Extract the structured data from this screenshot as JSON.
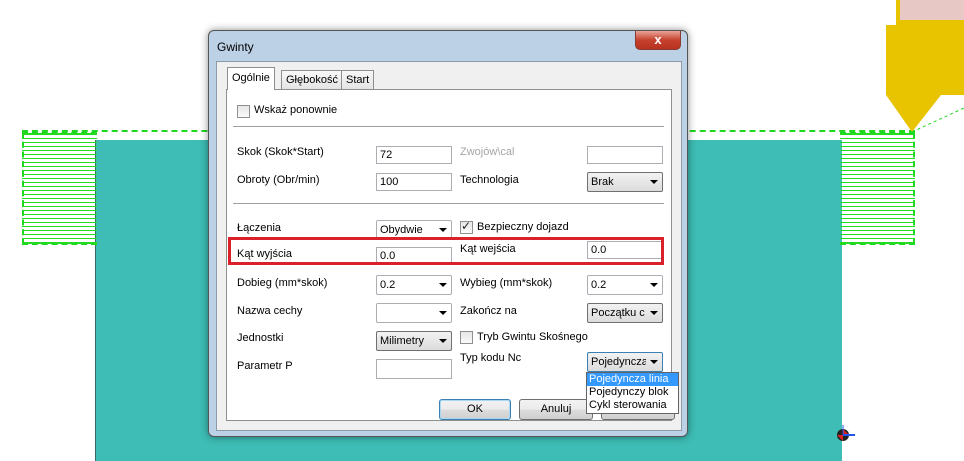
{
  "dialog": {
    "title": "Gwinty",
    "close_glyph": "x",
    "tabs": [
      {
        "label": "Ogólnie",
        "active": true
      },
      {
        "label": "Głębokość",
        "active": false
      },
      {
        "label": "Start",
        "active": false
      }
    ],
    "fields": {
      "show_again": {
        "label": "Wskaż ponownie",
        "checked": false
      },
      "pitch": {
        "label": "Skok (Skok*Start)",
        "value": "72"
      },
      "threads_per_inch": {
        "label": "Zwojów\\cal",
        "value": "",
        "disabled": true
      },
      "rpm": {
        "label": "Obroty (Obr/min)",
        "value": "100"
      },
      "technology": {
        "label": "Technologia",
        "value": "Brak"
      },
      "connections": {
        "label": "Łączenia",
        "value": "Obydwie"
      },
      "safe_approach": {
        "label": "Bezpieczny dojazd",
        "checked": true
      },
      "exit_angle": {
        "label": "Kąt wyjścia",
        "value": "0.0"
      },
      "entry_angle": {
        "label": "Kąt wejścia",
        "value": "0.0"
      },
      "approach": {
        "label": "Dobieg  (mm*skok)",
        "value": "0.2"
      },
      "overrun": {
        "label": "Wybieg (mm*skok)",
        "value": "0.2"
      },
      "feature_name": {
        "label": "Nazwa cechy",
        "value": ""
      },
      "finish_at": {
        "label": "Zakończ na",
        "value": "Początku c"
      },
      "units": {
        "label": "Jednostki",
        "value": "Milimetry"
      },
      "taper_thread": {
        "label": "Tryb Gwintu Skośnego",
        "checked": false
      },
      "nc_code_type": {
        "label": "Typ kodu Nc",
        "value": "Pojedyncza",
        "options": [
          "Pojedyncza linia",
          "Pojedynczy blok",
          "Cykl sterowania"
        ],
        "highlighted": "Pojedyncza linia"
      },
      "param_p": {
        "label": "Parametr P",
        "value": ""
      }
    },
    "buttons": {
      "ok": "OK",
      "cancel": "Anuluj"
    }
  },
  "colors": {
    "stock": "#3dbdb5",
    "thread": "#22dd22",
    "tool": "#e8c400",
    "highlight_box": "#d9202b",
    "selection": "#3399ff"
  }
}
